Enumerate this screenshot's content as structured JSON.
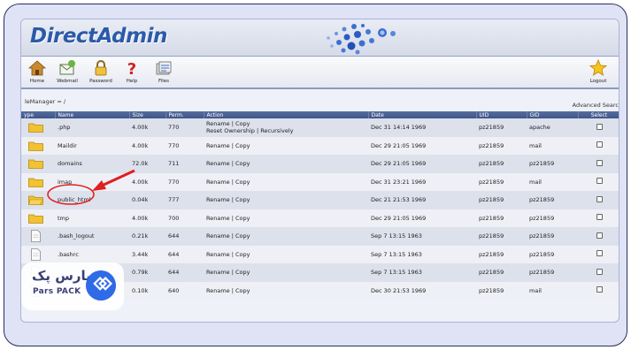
{
  "app": {
    "title": "DirectAdmin"
  },
  "toolbar": {
    "items": [
      {
        "label": "Home",
        "icon": "home-icon"
      },
      {
        "label": "Webmail",
        "icon": "webmail-icon"
      },
      {
        "label": "Password",
        "icon": "lock-icon"
      },
      {
        "label": "Help",
        "icon": "help-icon"
      },
      {
        "label": "Files",
        "icon": "files-icon"
      }
    ],
    "logout_label": "Logout"
  },
  "breadcrumb": "leManager = /",
  "advanced_search": "Advanced Searc",
  "table": {
    "headers": [
      "ype",
      "Name",
      "Size",
      "Perm.",
      "Action",
      "Date",
      "UID",
      "GID",
      "Select"
    ],
    "rows": [
      {
        "type": "folder",
        "name": ".php",
        "size": "4.00k",
        "perm": "770",
        "action": "Rename | Copy",
        "action2": "Reset Ownership | Recursively",
        "date": "Dec 31 14:14 1969",
        "uid": "pz21859",
        "gid": "apache"
      },
      {
        "type": "folder",
        "name": "Maildir",
        "size": "4.00k",
        "perm": "770",
        "action": "Rename | Copy",
        "date": "Dec 29 21:05 1969",
        "uid": "pz21859",
        "gid": "mail"
      },
      {
        "type": "folder",
        "name": "domains",
        "size": "72.0k",
        "perm": "711",
        "action": "Rename | Copy",
        "date": "Dec 29 21:05 1969",
        "uid": "pz21859",
        "gid": "pz21859"
      },
      {
        "type": "folder",
        "name": "imap",
        "size": "4.00k",
        "perm": "770",
        "action": "Rename | Copy",
        "date": "Dec 31 23:21 1969",
        "uid": "pz21859",
        "gid": "mail"
      },
      {
        "type": "folder-open",
        "name": "public_html",
        "size": "0.04k",
        "perm": "777",
        "action": "Rename | Copy",
        "date": "Dec 21 21:53 1969",
        "uid": "pz21859",
        "gid": "pz21859"
      },
      {
        "type": "folder",
        "name": "tmp",
        "size": "4.00k",
        "perm": "700",
        "action": "Rename | Copy",
        "date": "Dec 29 21:05 1969",
        "uid": "pz21859",
        "gid": "pz21859"
      },
      {
        "type": "file",
        "name": ".bash_logout",
        "size": "0.21k",
        "perm": "644",
        "action": "Rename | Copy",
        "date": "Sep 7 13:15 1963",
        "uid": "pz21859",
        "gid": "pz21859"
      },
      {
        "type": "file",
        "name": ".bashrc",
        "size": "3.44k",
        "perm": "644",
        "action": "Rename | Copy",
        "date": "Sep 7 13:15 1963",
        "uid": "pz21859",
        "gid": "pz21859"
      },
      {
        "type": "file",
        "name": "",
        "size": "0.79k",
        "perm": "644",
        "action": "Rename | Copy",
        "date": "Sep 7 13:15 1963",
        "uid": "pz21859",
        "gid": "pz21859"
      },
      {
        "type": "file",
        "name": "",
        "size": "0.10k",
        "perm": "640",
        "action": "Rename | Copy",
        "date": "Dec 30 21:53 1969",
        "uid": "pz21859",
        "gid": "mail"
      }
    ]
  },
  "watermark": {
    "text": "پارس پک",
    "subtext": "Pars PACK"
  },
  "colors": {
    "header": "#4a5f92",
    "logo": "#2c5aa8",
    "annotation": "#e01f1f",
    "folder": "#f2c230"
  }
}
